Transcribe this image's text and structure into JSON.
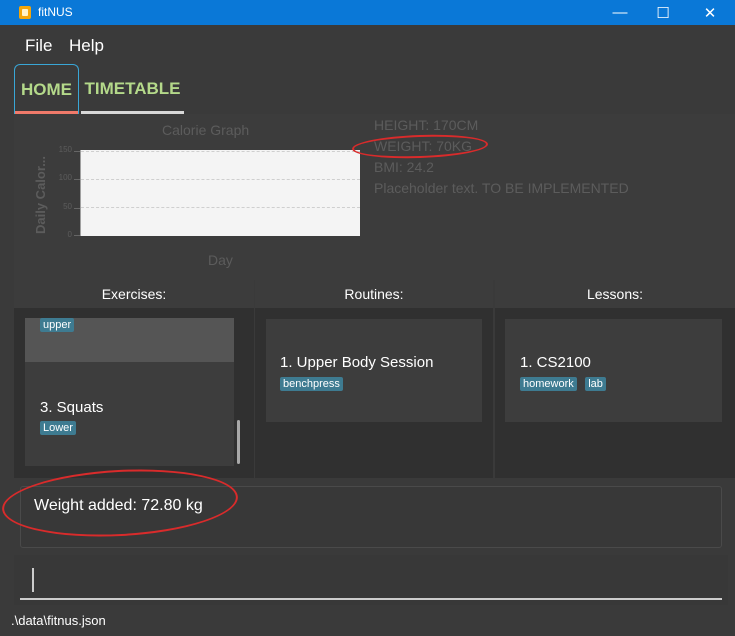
{
  "window": {
    "title": "fitNUS",
    "minimize": "—",
    "maximize": "☐",
    "close": "✕"
  },
  "menu": {
    "file": "File",
    "help": "Help"
  },
  "tabs": {
    "home": "HOME",
    "timetable": "TIMETABLE"
  },
  "graph": {
    "title": "Calorie Graph",
    "ylabel": "Daily Calor...",
    "xlabel": "Day",
    "ticks": [
      "150",
      "100",
      "50",
      "0"
    ]
  },
  "stats": {
    "height": "HEIGHT: 170CM",
    "weight": "WEIGHT: 70KG",
    "bmi": "BMI: 24.2",
    "placeholder": "Placeholder text. TO BE IMPLEMENTED"
  },
  "exercises": {
    "header": "Exercises:",
    "first_tag": "upper",
    "item3_title": "3.  Squats",
    "item3_tag": "Lower"
  },
  "routines": {
    "header": "Routines:",
    "item1_title": "1.  Upper Body Session",
    "item1_tag": "benchpress"
  },
  "lessons": {
    "header": "Lessons:",
    "item1_title": "1.  CS2100",
    "item1_tags": [
      "homework",
      "lab"
    ]
  },
  "result": {
    "message": "Weight added: 72.80 kg"
  },
  "status": {
    "path": ".\\data\\fitnus.json"
  },
  "colors": {
    "titlebar": "#0a78d7",
    "background": "#3a3a3a",
    "tab_text": "#b4d98a",
    "tag_bg": "#3e7b91",
    "annotation": "#d92b2b"
  }
}
